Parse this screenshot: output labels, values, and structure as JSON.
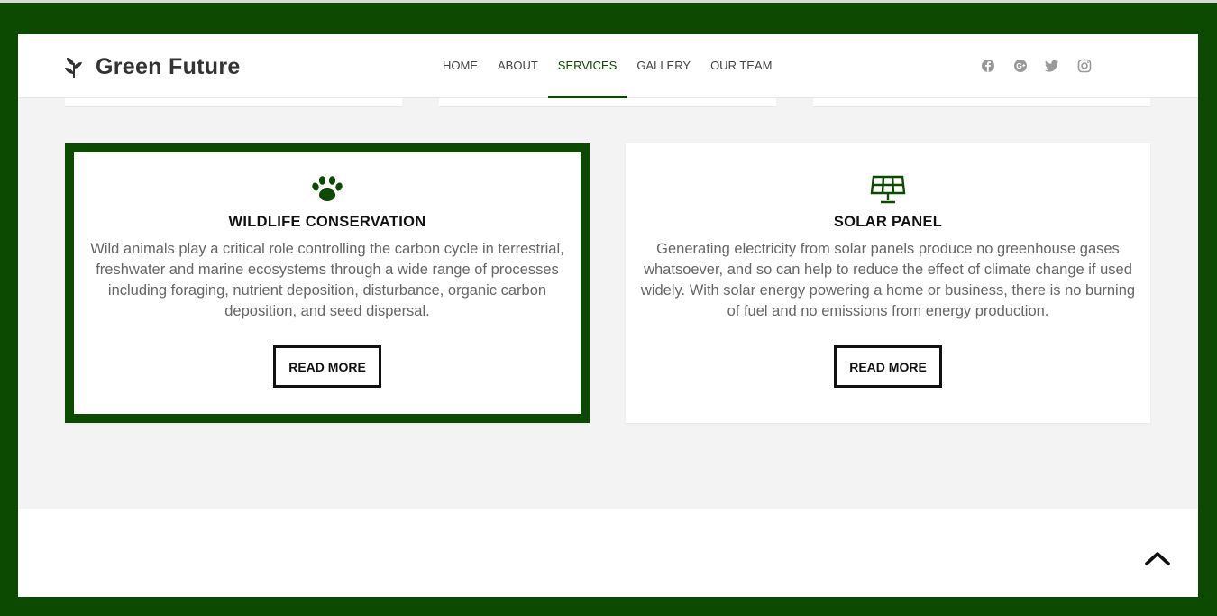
{
  "brand": {
    "name": "Green Future",
    "logo_icon": "sprout-icon"
  },
  "nav": {
    "items": [
      {
        "label": "HOME",
        "active": false
      },
      {
        "label": "ABOUT",
        "active": false
      },
      {
        "label": "SERVICES",
        "active": true
      },
      {
        "label": "GALLERY",
        "active": false
      },
      {
        "label": "OUR TEAM",
        "active": false
      }
    ]
  },
  "social": [
    "facebook-icon",
    "google-plus-icon",
    "twitter-icon",
    "instagram-icon"
  ],
  "services": [
    {
      "icon": "paw-icon",
      "title": "WILDLIFE CONSERVATION",
      "text": "Wild animals play a critical role controlling the carbon cycle in terrestrial, freshwater and marine ecosystems through a wide range of processes including foraging, nutrient deposition, disturbance, organic carbon deposition, and seed dispersal.",
      "button": "READ MORE"
    },
    {
      "icon": "solar-panel-icon",
      "title": "SOLAR PANEL",
      "text": "Generating electricity from solar panels produce no greenhouse gases whatsoever, and so can help to reduce the effect of climate change if used widely. With solar energy powering a home or business, there is no burning of fuel and no emissions from energy production.",
      "button": "READ MORE"
    }
  ],
  "colors": {
    "brand_green": "#0b4a00",
    "background": "#f3f3f3",
    "social_gray": "#999999"
  },
  "back_to_top_icon": "chevron-up-icon"
}
